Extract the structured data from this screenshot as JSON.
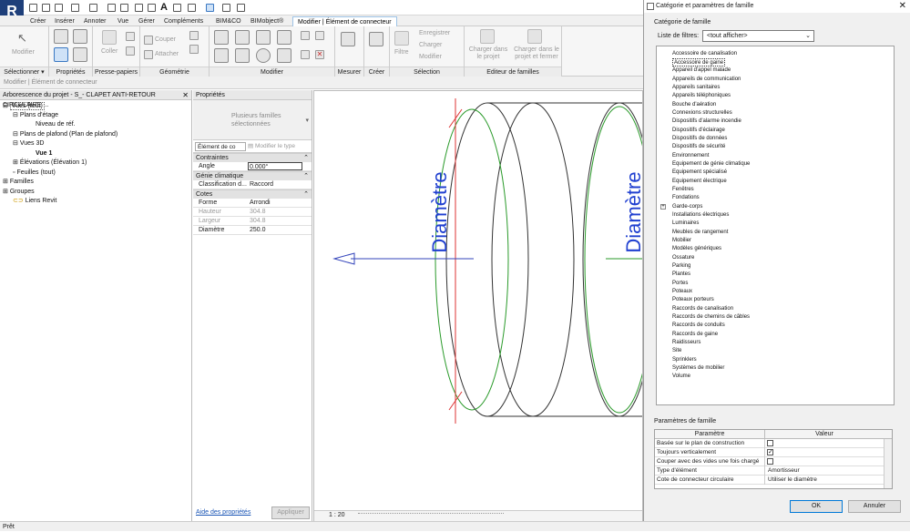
{
  "ribbon_tabs": [
    "Créer",
    "Insérer",
    "Annoter",
    "Vue",
    "Gérer",
    "Compléments",
    "BIM&CO",
    "BIMobject®",
    "Modifier | Élément de connecteur"
  ],
  "panels": {
    "select": "Sélectionner",
    "props": "Propriétés",
    "clipboard": "Presse-papiers",
    "geometry": "Géométrie",
    "modify": "Modifier",
    "measure": "Mesurer",
    "create": "Créer",
    "selection": "Sélection",
    "family_editor": "Editeur de familles"
  },
  "ribbon_items": {
    "modify": "Modifier",
    "paste": "Coller",
    "cut": "Couper",
    "attach": "Attacher",
    "filter": "Filtre",
    "save": "Enregistrer",
    "load": "Charger",
    "modify_sel": "Modifier",
    "load_project": "Charger dans le projet",
    "load_project_close": "Charger dans le projet et fermer"
  },
  "options_bar": "Modifier | Élément de connecteur",
  "browser": {
    "title": "Arborescence du projet - S_- CLAPET ANTI-RETOUR CIRCULAIRE ...",
    "items": [
      "Vues (tout)",
      "Plans d'étage",
      "Niveau de réf.",
      "Plans de plafond (Plan de plafond)",
      "Vues 3D",
      "Vue 1",
      "Élévations (Élévation 1)",
      "Feuilles (tout)",
      "Familles",
      "Groupes",
      "Liens Revit"
    ]
  },
  "properties": {
    "title": "Propriétés",
    "type_name": "Plusieurs familles sélectionnées",
    "selector": "Élément de co",
    "edit_type": "Modifier le type",
    "groups": {
      "constraints": "Contraintes",
      "mep": "Génie climatique",
      "dims": "Cotes"
    },
    "rows": {
      "angle": [
        "Angle",
        "0.000°"
      ],
      "classif": [
        "Classification d...",
        "Raccord"
      ],
      "forme": [
        "Forme",
        "Arrondi"
      ],
      "hauteur": [
        "Hauteur",
        "304.8"
      ],
      "largeur": [
        "Largeur",
        "304.8"
      ],
      "diametre": [
        "Diamètre",
        "250.0"
      ]
    },
    "help": "Aide des propriétés",
    "apply": "Appliquer"
  },
  "view": {
    "label1": "Diamètre",
    "label2": "Diamètre",
    "scale": "1 : 20"
  },
  "status": "Prêt",
  "dialog": {
    "title": "Catégorie et paramètres de famille",
    "category_label": "Catégorie de famille",
    "filter_label": "Liste de filtres:",
    "filter_value": "<tout afficher>",
    "categories": [
      "Accessoire de canalisation",
      "Accessoire de gaine",
      "Appareil d'appel malade",
      "Appareils de communication",
      "Appareils sanitaires",
      "Appareils téléphoniques",
      "Bouche d'aération",
      "Connexions structurelles",
      "Dispositifs d'alarme incendie",
      "Dispositifs d'éclairage",
      "Dispositifs de données",
      "Dispositifs de sécurité",
      "Environnement",
      "Equipement de génie climatique",
      "Equipement spécialisé",
      "Equipement électrique",
      "Fenêtres",
      "Fondations",
      "Garde-corps",
      "Installations électriques",
      "Luminaires",
      "Meubles de rangement",
      "Mobilier",
      "Modèles génériques",
      "Ossature",
      "Parking",
      "Plantes",
      "Portes",
      "Poteaux",
      "Poteaux porteurs",
      "Raccords de canalisation",
      "Raccords de chemins de câbles",
      "Raccords de conduits",
      "Raccords de gaine",
      "Raidisseurs",
      "Site",
      "Sprinklers",
      "Systèmes de mobilier",
      "Volume"
    ],
    "params_label": "Paramètres de famille",
    "col_param": "Paramètre",
    "col_value": "Valeur",
    "params": [
      [
        "Basée sur le plan de construction",
        ""
      ],
      [
        "Toujours verticalement",
        ""
      ],
      [
        "Couper avec des vides une fois chargé",
        ""
      ],
      [
        "Type d'élément",
        "Amortisseur"
      ],
      [
        "Cote de connecteur circulaire",
        "Utiliser le diamètre"
      ]
    ],
    "checks": [
      false,
      true,
      false
    ],
    "ok": "OK",
    "cancel": "Annuler"
  }
}
